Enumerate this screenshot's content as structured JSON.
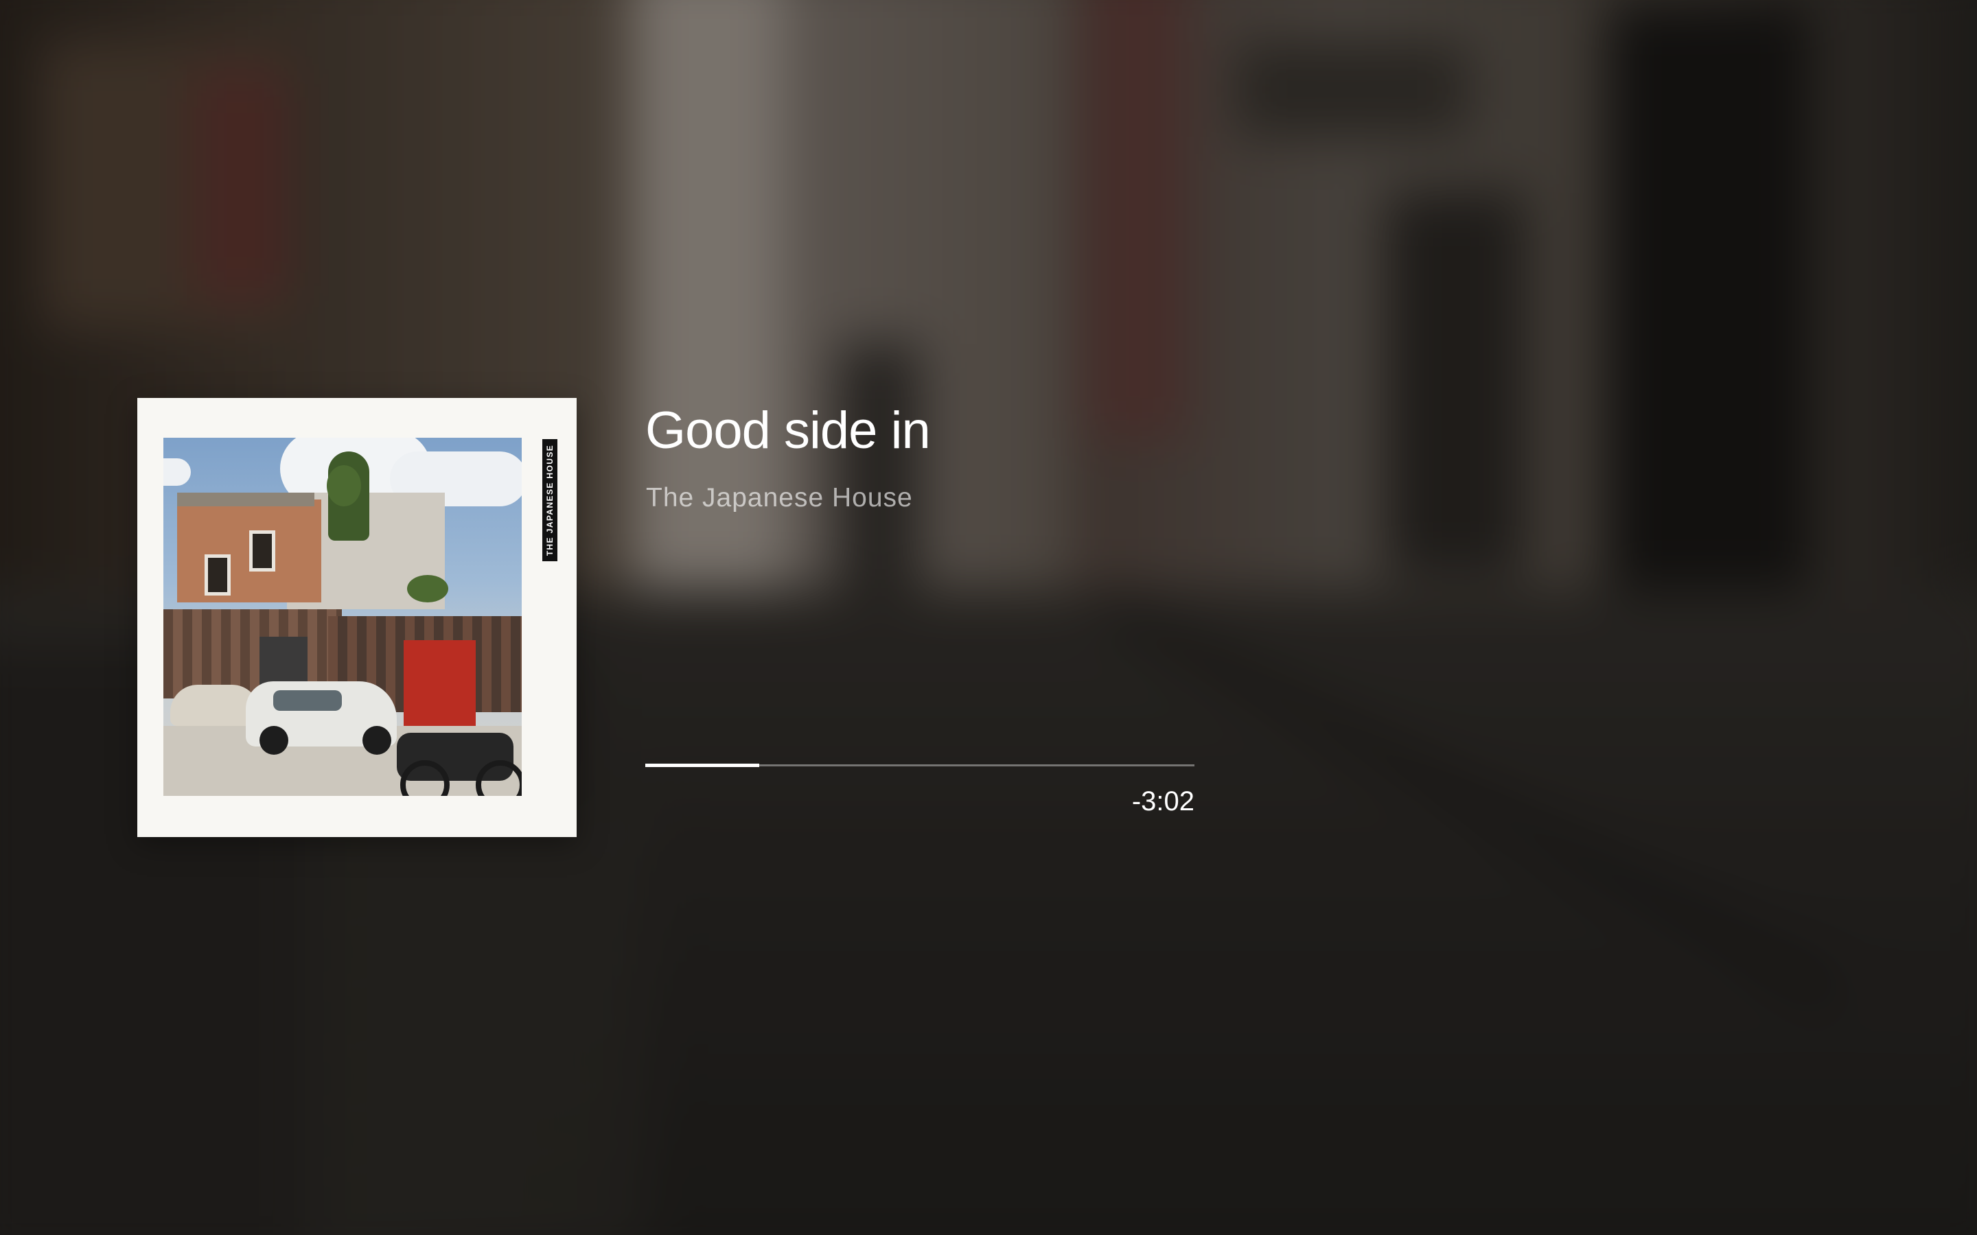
{
  "now_playing": {
    "track_title": "Good side in",
    "artist": "The Japanese House",
    "album_spine_text": "THE JAPANESE HOUSE",
    "progress_fraction": 0.207,
    "time_remaining": "-3:02"
  },
  "colors": {
    "text_primary": "#ffffff",
    "text_secondary": "rgba(255,255,255,0.62)",
    "progress_fill": "#ffffff",
    "progress_track": "rgba(255,255,255,0.38)",
    "cover_border": "#f8f7f3"
  }
}
